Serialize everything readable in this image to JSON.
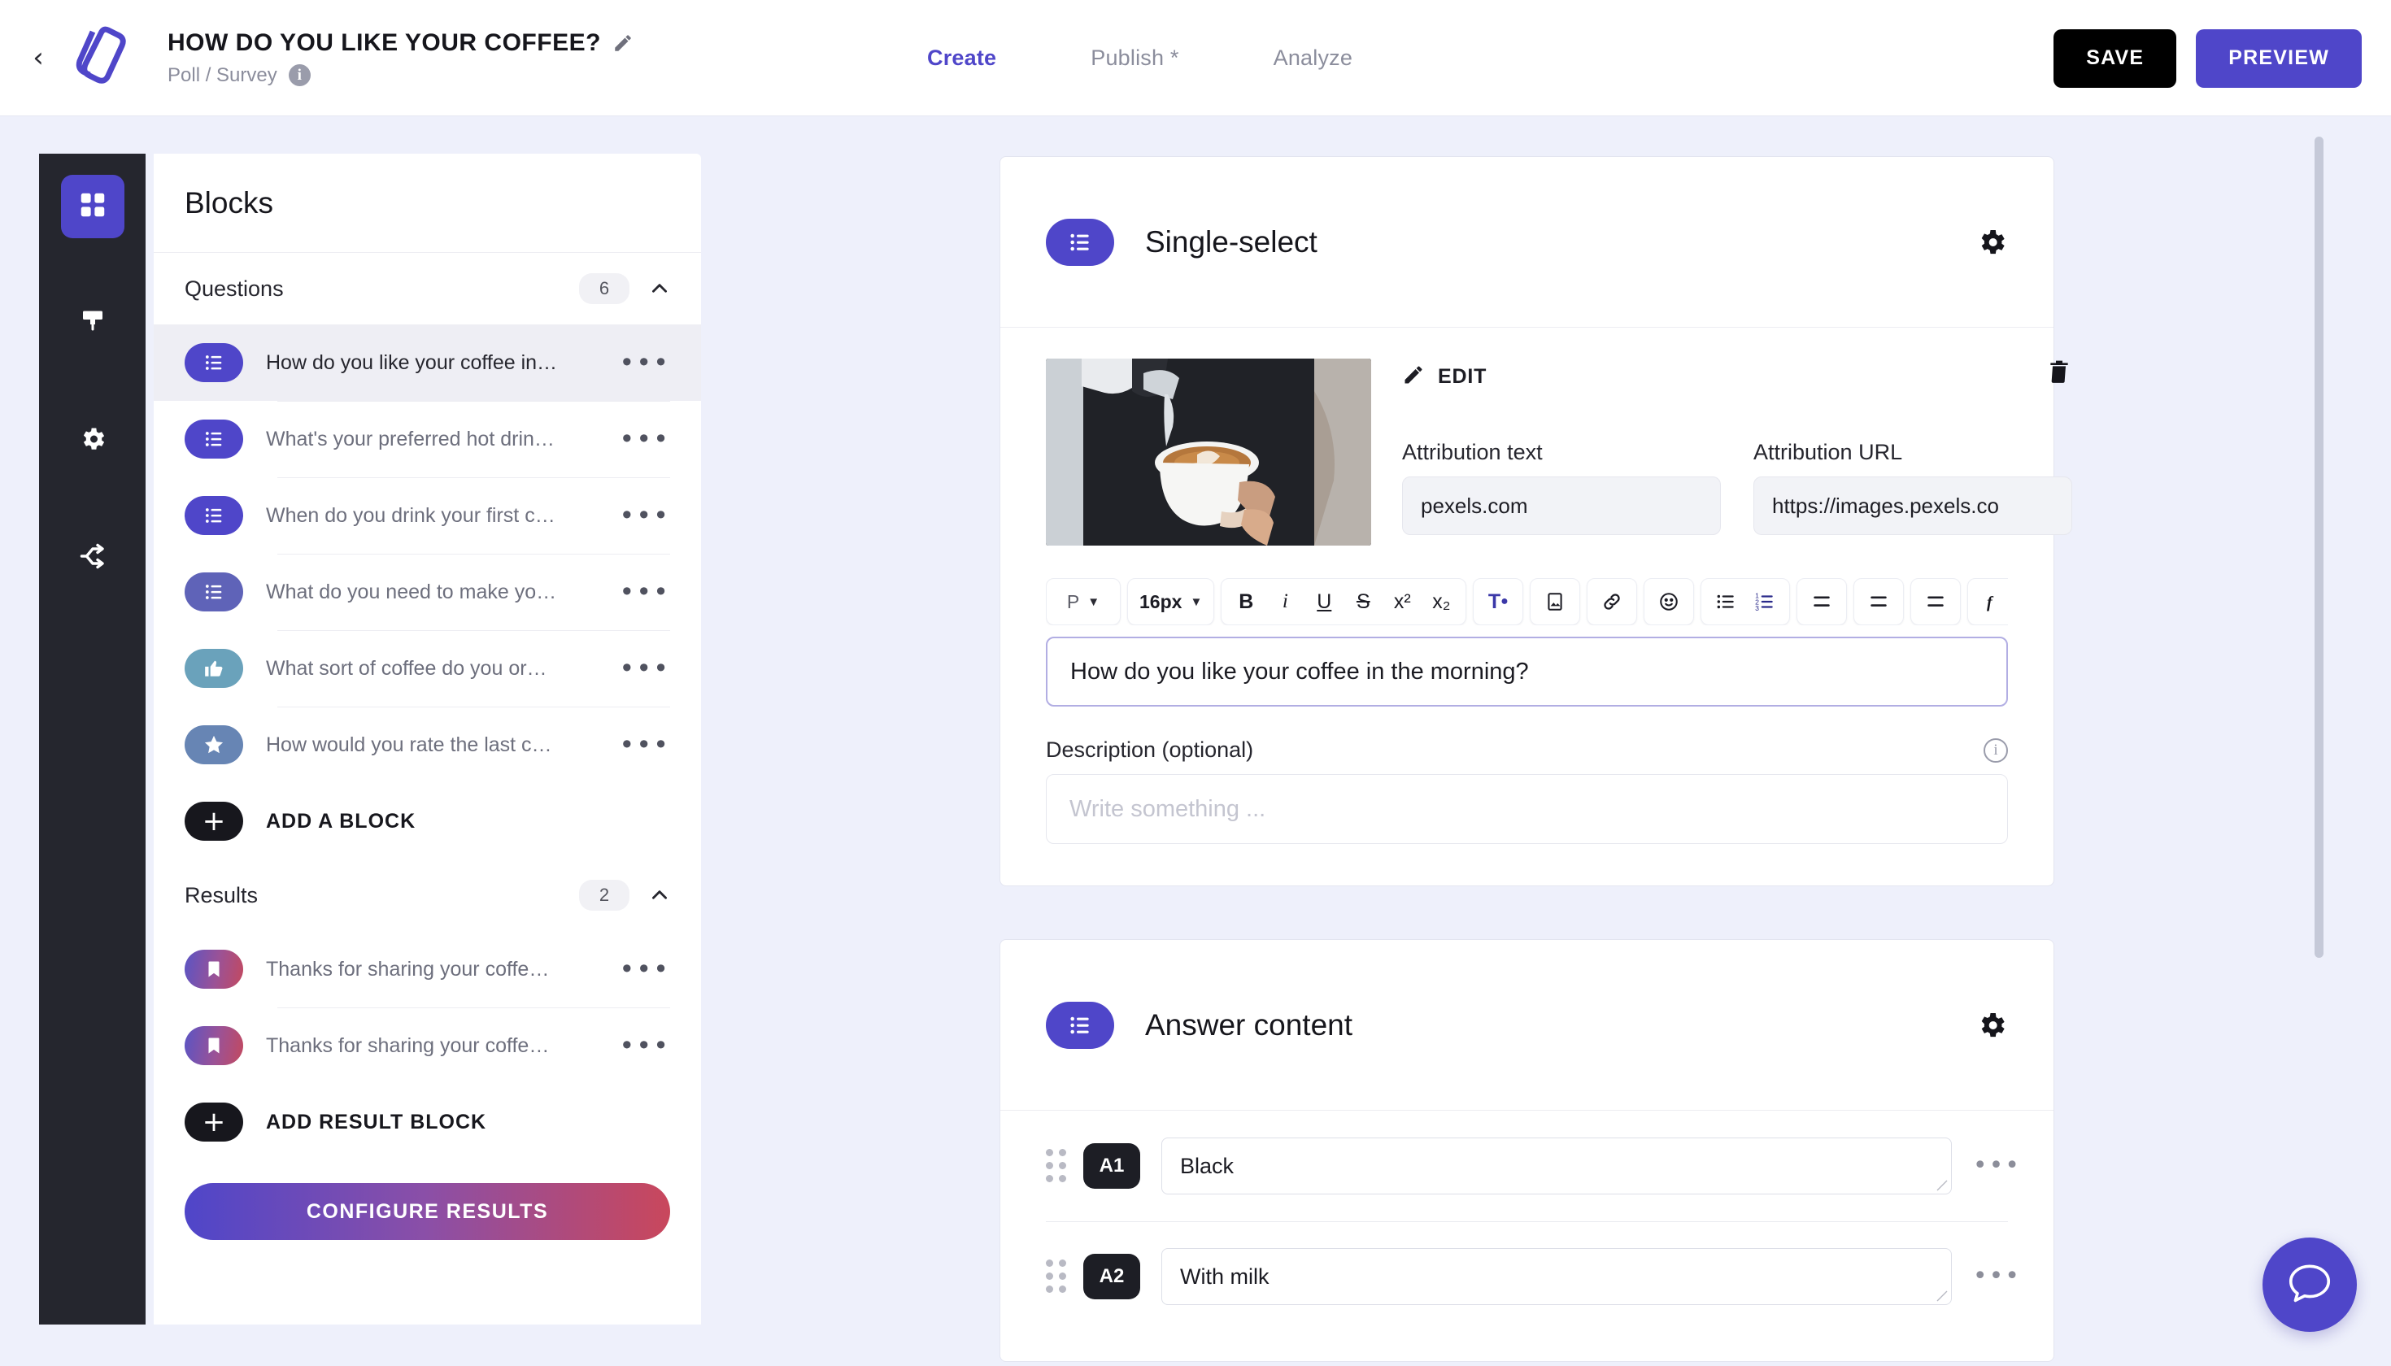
{
  "header": {
    "back_icon": "chevron-left-icon",
    "logo_icon": "app-logo-icon",
    "title": "HOW DO YOU LIKE YOUR COFFEE?",
    "edit_icon": "pencil-icon",
    "subtitle": "Poll / Survey",
    "info_icon": "info-icon",
    "info_glyph": "i",
    "tabs": [
      {
        "label": "Create",
        "active": true
      },
      {
        "label": "Publish *",
        "active": false
      },
      {
        "label": "Analyze",
        "active": false
      }
    ],
    "save_label": "SAVE",
    "preview_label": "PREVIEW",
    "accent_color": "#4f46c9",
    "save_color": "#000000"
  },
  "rail": {
    "items": [
      {
        "icon": "grid-blocks-icon",
        "active": true
      },
      {
        "icon": "paint-brush-icon",
        "active": false
      },
      {
        "icon": "gear-icon",
        "active": false
      },
      {
        "icon": "share-branch-icon",
        "active": false
      }
    ]
  },
  "blocks_panel": {
    "title": "Blocks",
    "questions_section": {
      "title": "Questions",
      "count": "6",
      "collapse_icon": "chevron-up-icon",
      "items": [
        {
          "label": "How do you like your coffee in…",
          "icon": "single-select-icon",
          "badge_color": "#4f46c9",
          "selected": true
        },
        {
          "label": "What's your preferred hot drin…",
          "icon": "single-select-icon",
          "badge_color": "#4f46c9",
          "selected": false
        },
        {
          "label": "When do you drink your first c…",
          "icon": "single-select-icon",
          "badge_color": "#4f46c9",
          "selected": false
        },
        {
          "label": "What do you need to make yo…",
          "icon": "multi-select-icon",
          "badge_color": "#5f63b8",
          "selected": false
        },
        {
          "label": "What sort of coffee do you or…",
          "icon": "thumbs-up-icon",
          "badge_color": "#6aa2bb",
          "selected": false
        },
        {
          "label": "How would you rate the last c…",
          "icon": "star-icon",
          "badge_color": "#6785b4",
          "selected": false
        }
      ],
      "add_label": "ADD A BLOCK",
      "add_icon": "plus-icon"
    },
    "results_section": {
      "title": "Results",
      "count": "2",
      "collapse_icon": "chevron-up-icon",
      "items": [
        {
          "label": "Thanks for sharing your coffe…",
          "icon": "bookmark-icon"
        },
        {
          "label": "Thanks for sharing your coffe…",
          "icon": "bookmark-icon"
        }
      ],
      "add_label": "ADD RESULT BLOCK",
      "add_icon": "plus-icon"
    },
    "configure_label": "CONFIGURE RESULTS",
    "menu_dots": "•••"
  },
  "single_select_card": {
    "badge_icon": "single-select-icon",
    "title": "Single-select",
    "gear_icon": "gear-icon",
    "image_alt": "barista pouring milk into latte cup",
    "edit_label": "EDIT",
    "edit_icon": "pencil-icon",
    "trash_icon": "trash-icon",
    "attribution_text_label": "Attribution text",
    "attribution_text_value": "pexels.com",
    "attribution_url_label": "Attribution URL",
    "attribution_url_value": "https://images.pexels.co",
    "toolbar": {
      "paragraph_style": "P",
      "font_size": "16px",
      "caret": "▾",
      "bold": "B",
      "italic": "i",
      "underline": "U",
      "strike": "S",
      "superscript": "x²",
      "subscript": "x₂",
      "text_color": "T",
      "image": "image-icon",
      "link": "link-icon",
      "emoji": "emoji-icon",
      "bullet_list": "bullet-list-icon",
      "numbered_list": "numbered-list-icon",
      "align_left": "align-left-icon",
      "align_center": "align-center-icon",
      "align_right": "align-right-icon",
      "formula": "formula-icon",
      "clear_format": "clear-format-icon",
      "more": "•••"
    },
    "question_value": "How do you like your coffee in the morning?",
    "description_label": "Description (optional)",
    "description_placeholder": "Write something ...",
    "description_value": "",
    "info_glyph": "i"
  },
  "answer_card": {
    "badge_icon": "single-select-icon",
    "title": "Answer content",
    "gear_icon": "gear-icon",
    "rows": [
      {
        "badge": "A1",
        "value": "Black",
        "menu": "•••"
      },
      {
        "badge": "A2",
        "value": "With milk",
        "menu": "•••"
      }
    ]
  },
  "chat": {
    "icon": "chat-bubble-icon",
    "color": "#4f46c9"
  },
  "scrollbar": {
    "name": "vertical-scrollbar"
  }
}
